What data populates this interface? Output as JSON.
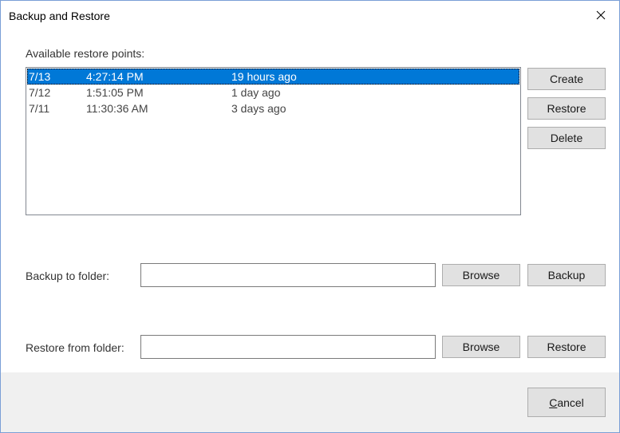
{
  "window": {
    "title": "Backup and Restore"
  },
  "restore_points": {
    "label": "Available restore points:",
    "rows": [
      {
        "date": "7/13",
        "time": "4:27:14 PM",
        "ago": "19 hours ago",
        "selected": true
      },
      {
        "date": "7/12",
        "time": "1:51:05 PM",
        "ago": "1 day ago",
        "selected": false
      },
      {
        "date": "7/11",
        "time": "11:30:36 AM",
        "ago": "3 days ago",
        "selected": false
      }
    ]
  },
  "actions": {
    "create": "Create",
    "restore": "Restore",
    "delete": "Delete"
  },
  "backup": {
    "label": "Backup to folder:",
    "value": "",
    "browse": "Browse",
    "action": "Backup"
  },
  "restore_from": {
    "label": "Restore from folder:",
    "value": "",
    "browse": "Browse",
    "action": "Restore"
  },
  "footer": {
    "cancel_accel": "C",
    "cancel_rest": "ancel"
  },
  "colors": {
    "selection": "#0078d7",
    "button_face": "#e1e1e1",
    "footer_bg": "#f0f0f0"
  }
}
